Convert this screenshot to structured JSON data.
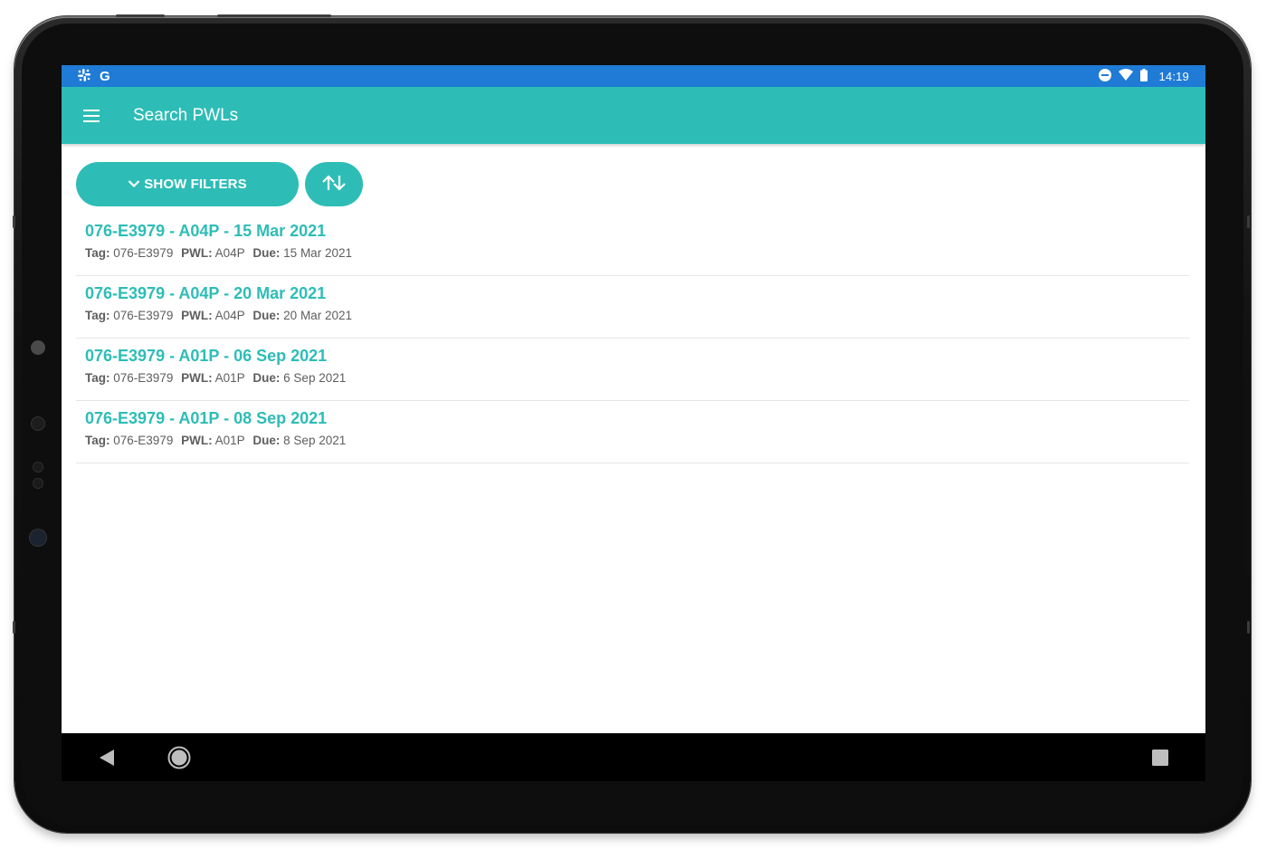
{
  "status_bar": {
    "left_icons": [
      "slack-icon",
      "google-icon"
    ],
    "google_letter": "G",
    "right_icons": [
      "do-not-disturb-icon",
      "wifi-icon",
      "battery-icon"
    ],
    "time": "14:19"
  },
  "app_bar": {
    "menu_icon": "hamburger-menu-icon",
    "title": "Search PWLs"
  },
  "toolbar": {
    "filters_label": "SHOW FILTERS",
    "filters_icon": "chevron-down-icon",
    "sort_icon": "sort-arrows-icon"
  },
  "pwl_list": [
    {
      "title": "076-E3979 - A04P - 15 Mar 2021",
      "tag_label": "Tag:",
      "tag": "076-E3979",
      "pwl_label": "PWL:",
      "pwl": "A04P",
      "due_label": "Due:",
      "due": "15 Mar 2021"
    },
    {
      "title": "076-E3979 - A04P - 20 Mar 2021",
      "tag_label": "Tag:",
      "tag": "076-E3979",
      "pwl_label": "PWL:",
      "pwl": "A04P",
      "due_label": "Due:",
      "due": "20 Mar 2021"
    },
    {
      "title": "076-E3979 - A01P - 06 Sep 2021",
      "tag_label": "Tag:",
      "tag": "076-E3979",
      "pwl_label": "PWL:",
      "pwl": "A01P",
      "due_label": "Due:",
      "due": "6 Sep 2021"
    },
    {
      "title": "076-E3979 - A01P - 08 Sep 2021",
      "tag_label": "Tag:",
      "tag": "076-E3979",
      "pwl_label": "PWL:",
      "pwl": "A01P",
      "due_label": "Due:",
      "due": "8 Sep 2021"
    }
  ],
  "nav_bar": {
    "back_icon": "back-triangle-icon",
    "home_icon": "home-circle-icon",
    "recents_icon": "recents-square-icon"
  },
  "colors": {
    "status_bar": "#1f7bd6",
    "accent": "#2dbdb6",
    "meta_text": "#5e5e5e",
    "nav_bar": "#000000"
  }
}
